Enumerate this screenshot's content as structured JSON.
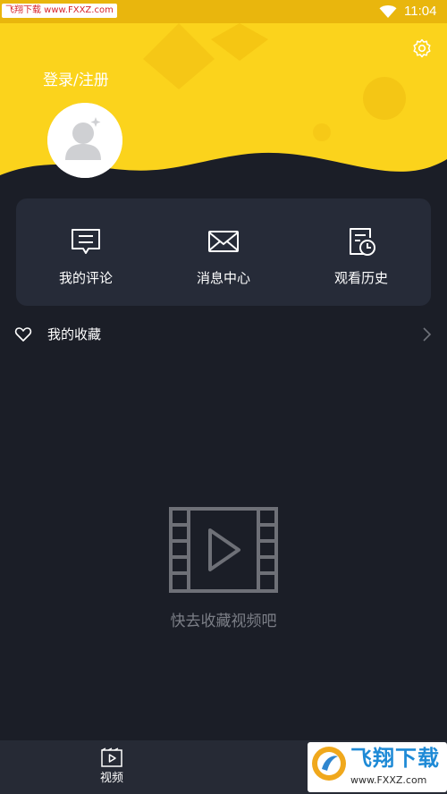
{
  "status_bar": {
    "watermark": "飞翔下载 www.FXXZ.com",
    "time": "11:04"
  },
  "header": {
    "login_label": "登录/注册"
  },
  "actions": [
    {
      "label": "我的评论",
      "icon": "comment-icon"
    },
    {
      "label": "消息中心",
      "icon": "mail-icon"
    },
    {
      "label": "观看历史",
      "icon": "history-icon"
    }
  ],
  "favorites": {
    "label": "我的收藏"
  },
  "empty_state": {
    "text": "快去收藏视频吧"
  },
  "bottom_nav": {
    "video_label": "视频"
  },
  "watermark_bottom": {
    "title": "飞翔下载",
    "url": "www.FXXZ.com"
  },
  "colors": {
    "header_yellow": "#fbd31c",
    "background": "#1b1e27",
    "card": "#262b38",
    "muted_text": "#7b7e86"
  }
}
